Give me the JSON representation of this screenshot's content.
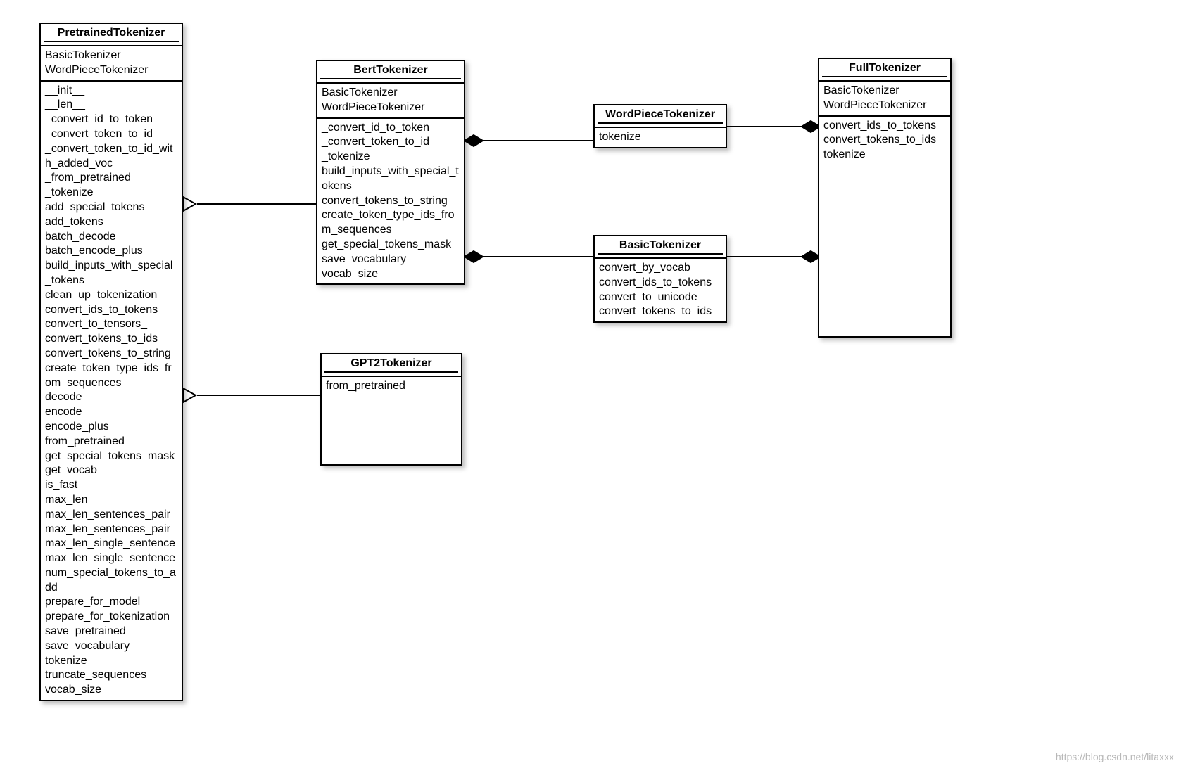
{
  "classes": {
    "pretrained": {
      "title": "PretrainedTokenizer",
      "attrs": [
        "BasicTokenizer",
        "WordPieceTokenizer"
      ],
      "methods": [
        "__init__",
        "__len__",
        "_convert_id_to_token",
        "_convert_token_to_id",
        "_convert_token_to_id_with_added_voc",
        "_from_pretrained",
        "_tokenize",
        "add_special_tokens",
        "add_tokens",
        "batch_decode",
        "batch_encode_plus",
        "build_inputs_with_special_tokens",
        "clean_up_tokenization",
        "convert_ids_to_tokens",
        "convert_to_tensors_",
        "convert_tokens_to_ids",
        "convert_tokens_to_string",
        "create_token_type_ids_from_sequences",
        "decode",
        "encode",
        "encode_plus",
        "from_pretrained",
        "get_special_tokens_mask",
        "get_vocab",
        "is_fast",
        "max_len",
        "max_len_sentences_pair",
        "max_len_sentences_pair",
        "max_len_single_sentence",
        "max_len_single_sentence",
        "num_special_tokens_to_add",
        "prepare_for_model",
        "prepare_for_tokenization",
        "save_pretrained",
        "save_vocabulary",
        "tokenize",
        "truncate_sequences",
        "vocab_size"
      ]
    },
    "bert": {
      "title": "BertTokenizer",
      "attrs": [
        "BasicTokenizer",
        "WordPieceTokenizer"
      ],
      "methods": [
        "_convert_id_to_token",
        "_convert_token_to_id",
        "_tokenize",
        "build_inputs_with_special_tokens",
        "convert_tokens_to_string",
        "create_token_type_ids_from_sequences",
        "get_special_tokens_mask",
        "save_vocabulary",
        "vocab_size"
      ]
    },
    "wordpiece": {
      "title": "WordPieceTokenizer",
      "attrs": [],
      "methods": [
        "tokenize"
      ]
    },
    "basic": {
      "title": "BasicTokenizer",
      "attrs": [],
      "methods": [
        "convert_by_vocab",
        "convert_ids_to_tokens",
        "convert_to_unicode",
        "convert_tokens_to_ids"
      ]
    },
    "full": {
      "title": "FullTokenizer",
      "attrs": [
        "BasicTokenizer",
        "WordPieceTokenizer"
      ],
      "methods": [
        "convert_ids_to_tokens",
        "convert_tokens_to_ids",
        "tokenize"
      ]
    },
    "gpt2": {
      "title": "GPT2Tokenizer",
      "attrs": [],
      "methods": [
        "from_pretrained"
      ]
    }
  },
  "watermark": "https://blog.csdn.net/litaxxx"
}
